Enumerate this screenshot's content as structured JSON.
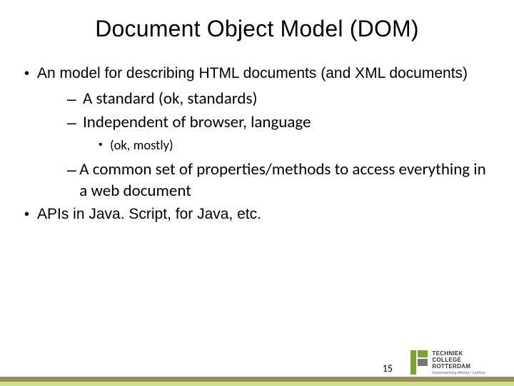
{
  "title": "Document Object Model (DOM)",
  "bullets": {
    "b1": "An model for describing HTML documents (and XML documents)",
    "sub1": "A standard (ok, standards)",
    "sub2": "Independent of browser, language",
    "subsub1": "(ok, mostly)",
    "sub3": "A common set of properties/methods to access everything in a web document",
    "b2": "APIs in Java. Script, for Java, etc."
  },
  "page_number": "15",
  "logo": {
    "line1": "TECHNIEK",
    "line2": "COLLEGE",
    "line3": "ROTTERDAM",
    "tag": "Samenwerking Albeda / Zadkine"
  }
}
